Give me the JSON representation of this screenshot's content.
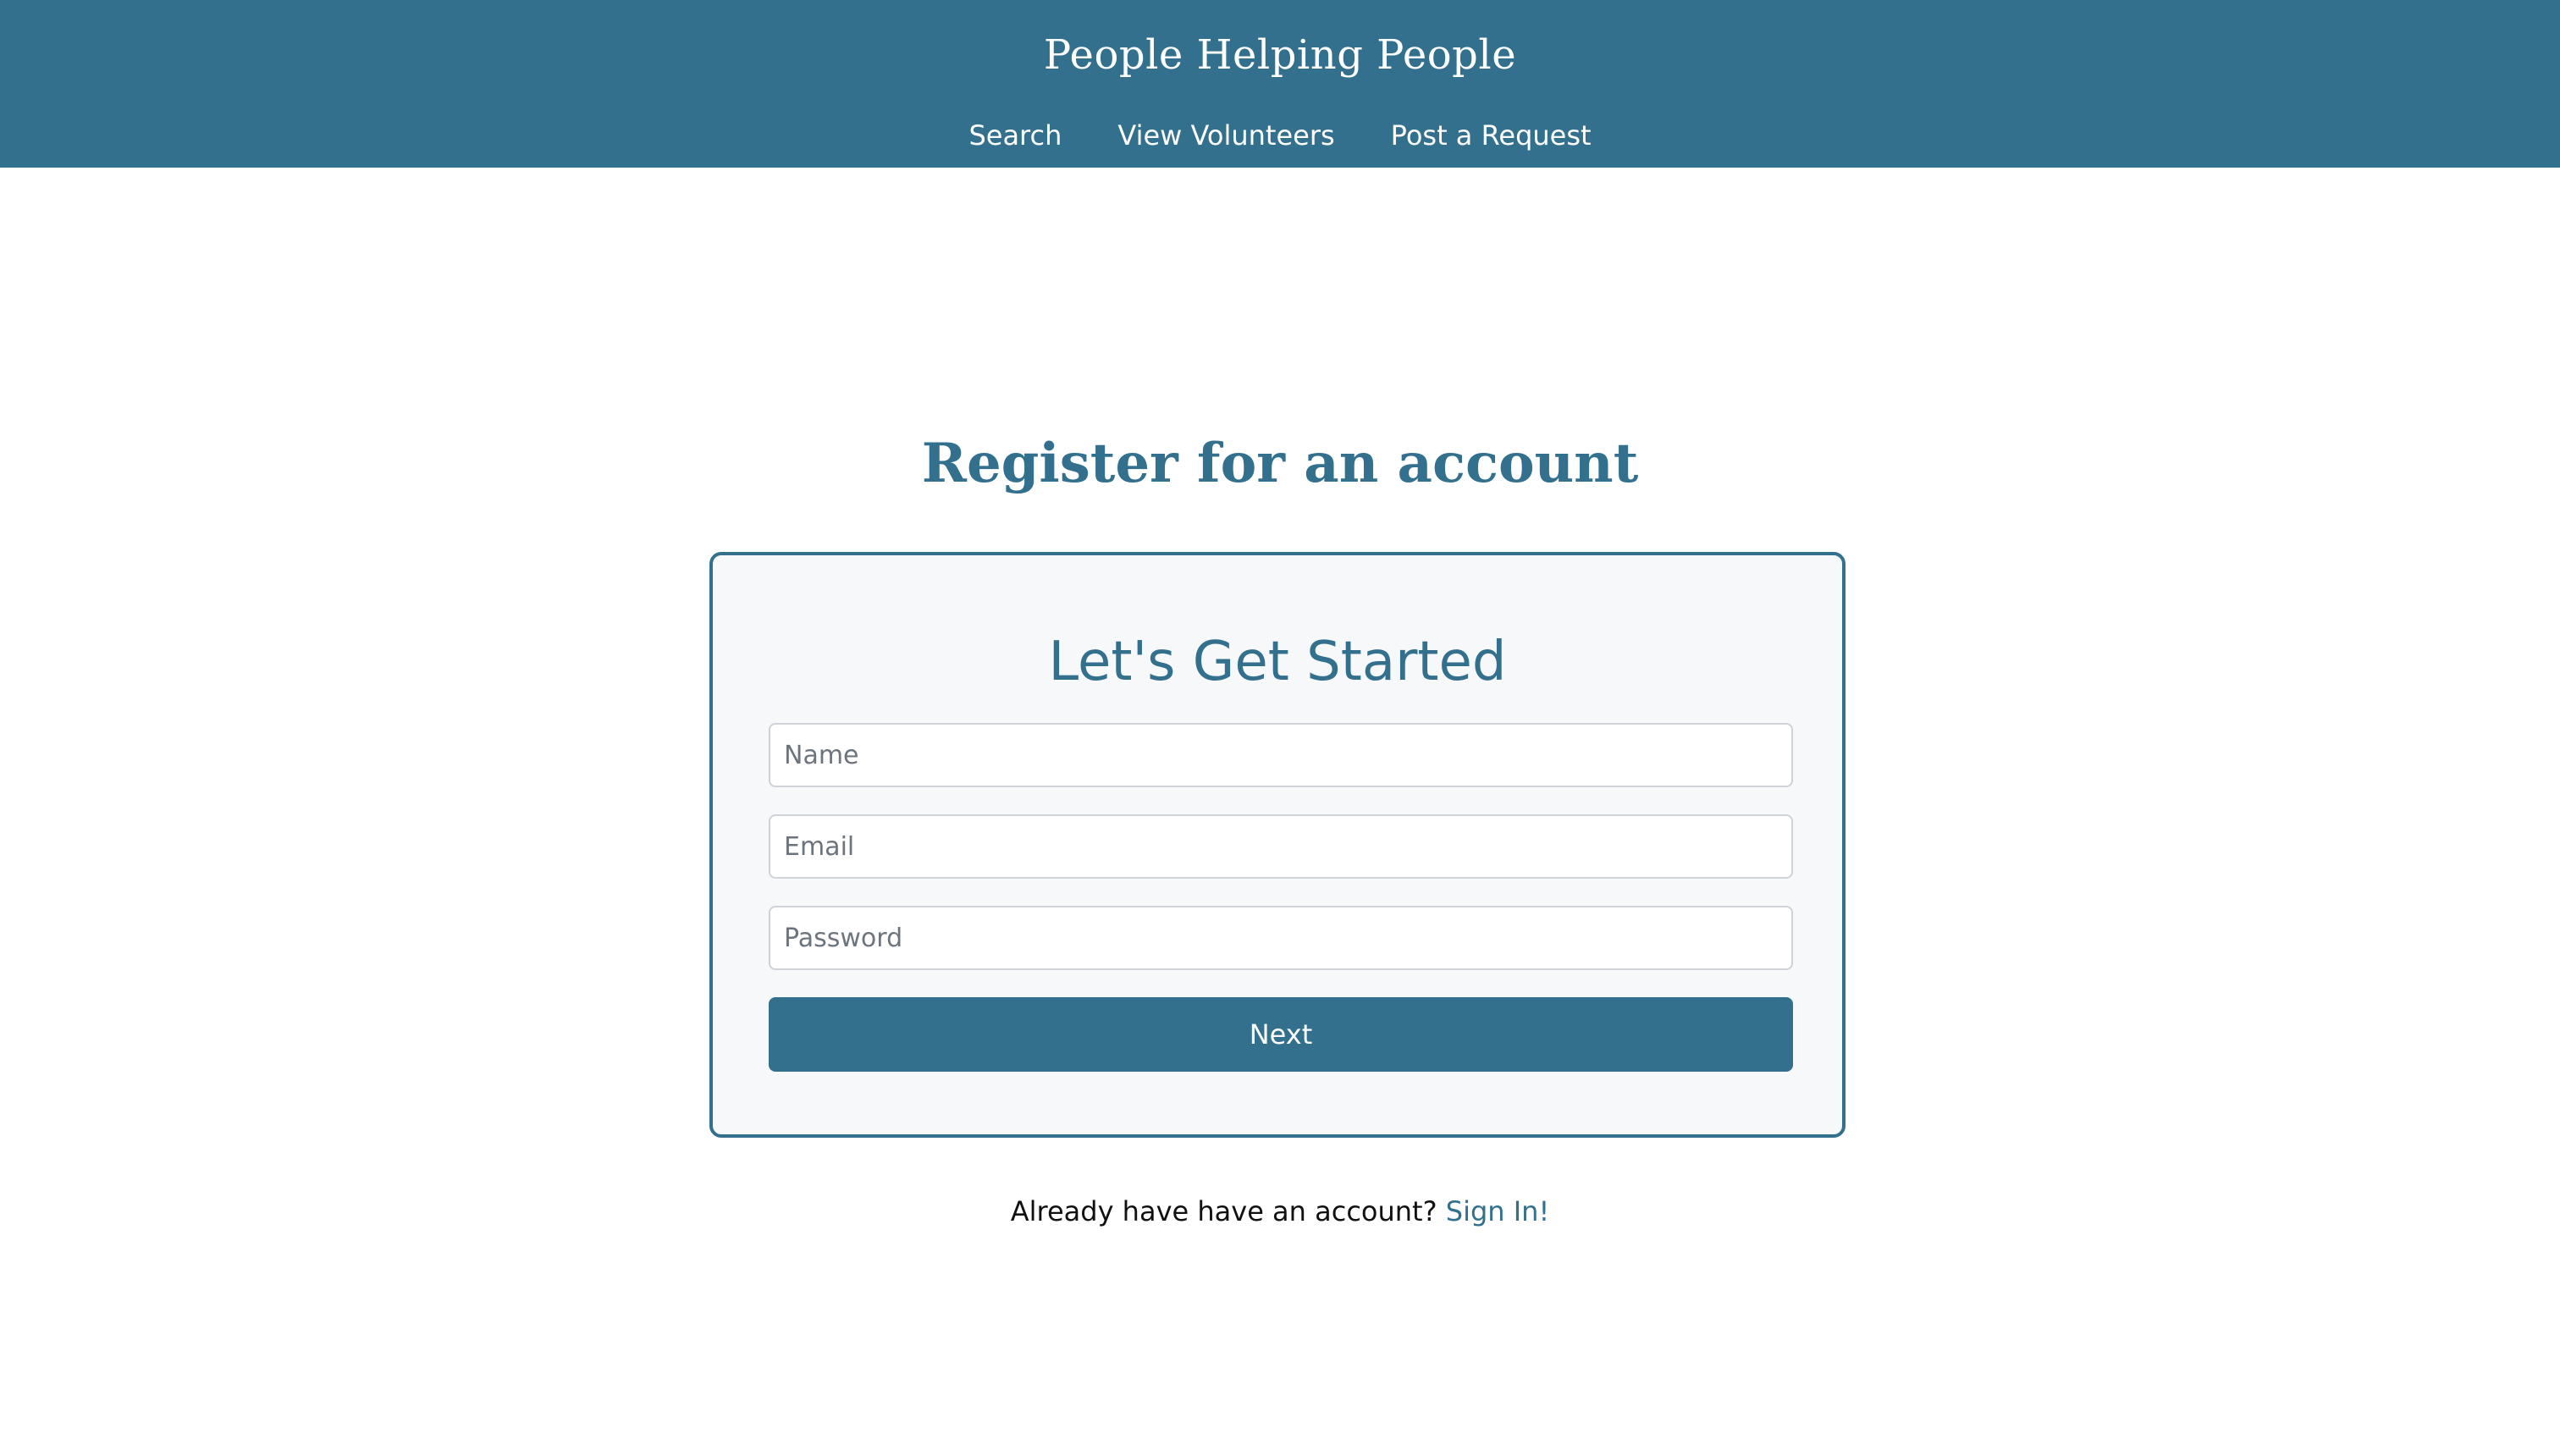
{
  "header": {
    "title": "People Helping People",
    "nav": [
      {
        "label": "Search"
      },
      {
        "label": "View Volunteers"
      },
      {
        "label": "Post a Request"
      }
    ]
  },
  "main": {
    "heading": "Register for an account",
    "card": {
      "title": "Let's Get Started",
      "name_placeholder": "Name",
      "email_placeholder": "Email",
      "password_placeholder": "Password",
      "next_label": "Next"
    },
    "signin_prompt": "Already have have an account?",
    "signin_link": "Sign In!"
  },
  "colors": {
    "brand": "#33708e",
    "card_background": "#f6f8fa",
    "page_background": "#ffffff"
  }
}
